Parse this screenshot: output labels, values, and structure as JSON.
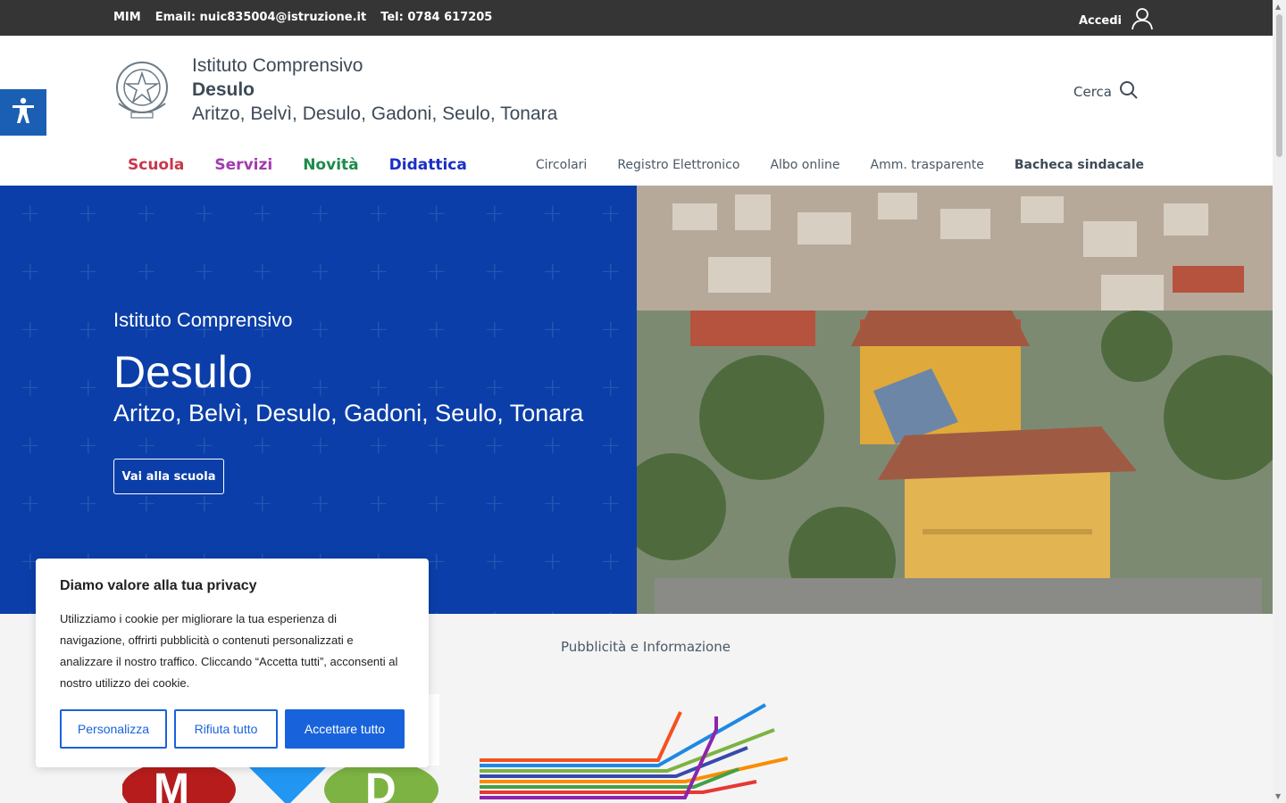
{
  "topbar": {
    "mim": "MIM",
    "email": "Email: nuic835004@istruzione.it",
    "phone": "Tel: 0784 617205",
    "login": "Accedi"
  },
  "brand": {
    "line1": "Istituto Comprensivo",
    "line2": "Desulo",
    "line3": "Aritzo, Belvì, Desulo, Gadoni, Seulo, Tonara"
  },
  "search": {
    "label": "Cerca"
  },
  "mainnav": [
    {
      "label": "Scuola",
      "color": "#c8374b"
    },
    {
      "label": "Servizi",
      "color": "#a23bb0"
    },
    {
      "label": "Novità",
      "color": "#1d8a4a"
    },
    {
      "label": "Didattica",
      "color": "#1b2fc4"
    }
  ],
  "subnav": [
    "Circolari",
    "Registro Elettronico",
    "Albo online",
    "Amm. trasparente",
    "Bacheca sindacale"
  ],
  "hero": {
    "line1": "Istituto Comprensivo",
    "line2": "Desulo",
    "line3": "Aritzo, Belvì, Desulo, Gadoni, Seulo, Tonara",
    "button": "Vai alla scuola",
    "bg_color": "#0b3ea8"
  },
  "lower": {
    "heading": "Pubblicità e Informazione"
  },
  "cookie": {
    "title": "Diamo valore alla tua privacy",
    "text": "Utilizziamo i cookie per migliorare la tua esperienza di navigazione, offrirti pubblicità o contenuti personalizzati e analizzare il nostro traffico. Cliccando “Accetta tutti”, acconsenti al nostro utilizzo dei cookie.",
    "btn_customize": "Personalizza",
    "btn_reject": "Rifiuta tutto",
    "btn_accept": "Accettare tutto",
    "accent": "#1863dc"
  },
  "icons": [
    "user-icon",
    "search-icon",
    "accessibility-icon",
    "emblem-icon"
  ]
}
